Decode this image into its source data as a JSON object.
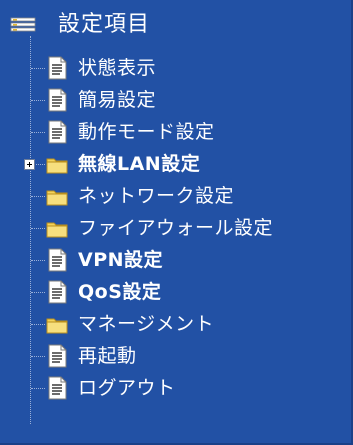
{
  "tree": {
    "root": {
      "label": "設定項目",
      "icon": "settings-tree-icon"
    },
    "items": [
      {
        "label": "状態表示",
        "icon": "page-icon"
      },
      {
        "label": "簡易設定",
        "icon": "page-icon"
      },
      {
        "label": "動作モード設定",
        "icon": "page-icon"
      },
      {
        "label": "無線LAN設定",
        "icon": "folder-icon",
        "expandable": true
      },
      {
        "label": "ネットワーク設定",
        "icon": "folder-icon"
      },
      {
        "label": "ファイアウォール設定",
        "icon": "folder-icon"
      },
      {
        "label": "VPN設定",
        "icon": "page-icon"
      },
      {
        "label": "QoS設定",
        "icon": "page-icon"
      },
      {
        "label": "マネージメント",
        "icon": "folder-icon"
      },
      {
        "label": "再起動",
        "icon": "page-icon"
      },
      {
        "label": "ログアウト",
        "icon": "page-icon"
      }
    ]
  },
  "colors": {
    "background": "#2251a5",
    "text": "#ffffff",
    "folder": "#f3d35a",
    "page": "#ffffff"
  }
}
